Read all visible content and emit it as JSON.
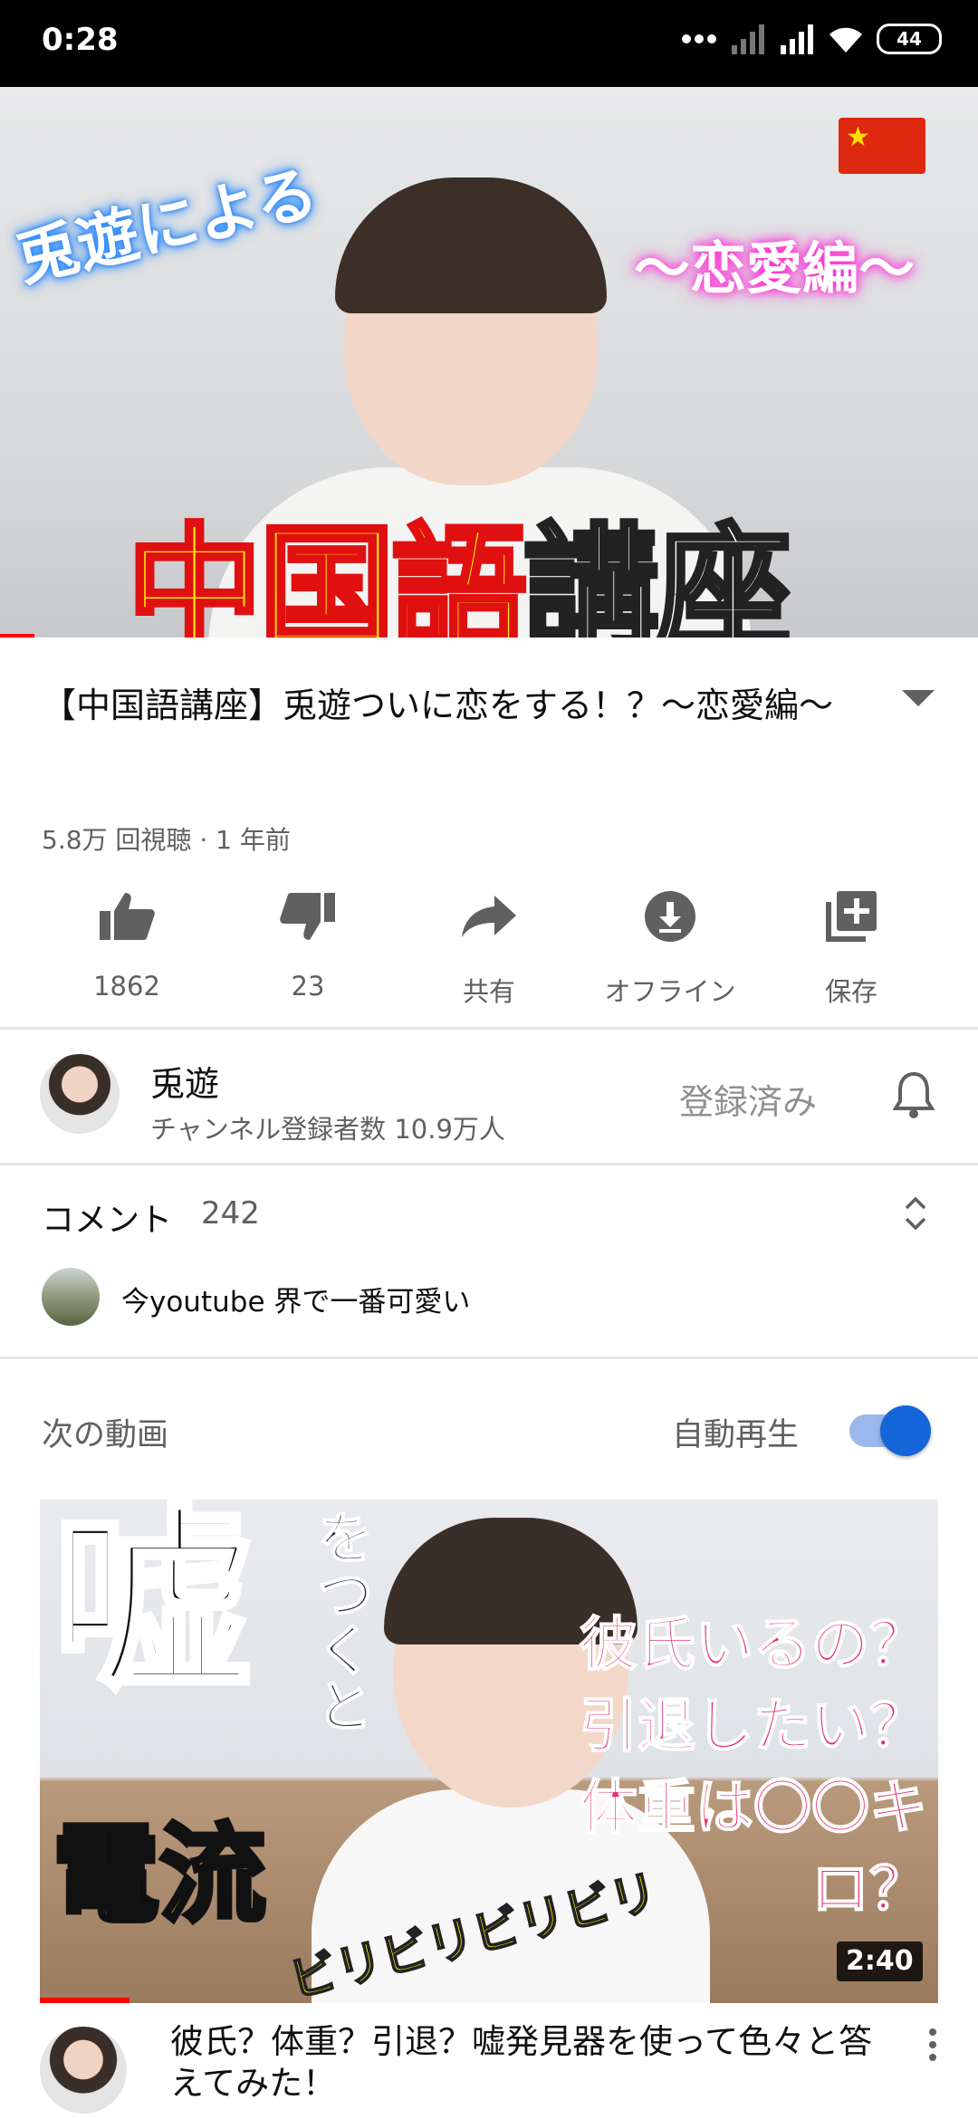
{
  "status_bar": {
    "time": "0:28",
    "battery": "44",
    "icons": [
      "dots-icon",
      "signal-off-icon",
      "signal-icon",
      "wifi-icon",
      "battery-icon"
    ]
  },
  "player": {
    "overlay_top_left": "兎遊による",
    "overlay_top_right": "～恋愛編～",
    "overlay_big_yellow": "中国語",
    "overlay_big_white": "講座",
    "flag": "china-flag",
    "progress_fraction": 0.035
  },
  "video": {
    "title": "【中国語講座】兎遊ついに恋をする！？～恋愛編～",
    "meta": "5.8万 回視聴 · 1 年前"
  },
  "actions": [
    {
      "icon": "thumbs-up-icon",
      "label": "1862"
    },
    {
      "icon": "thumbs-down-icon",
      "label": "23"
    },
    {
      "icon": "share-icon",
      "label": "共有"
    },
    {
      "icon": "download-icon",
      "label": "オフライン"
    },
    {
      "icon": "save-playlist-icon",
      "label": "保存"
    }
  ],
  "channel": {
    "name": "兎遊",
    "subscribers": "チャンネル登録者数 10.9万人",
    "subscribed_label": "登録済み"
  },
  "comments": {
    "label": "コメント",
    "count": "242",
    "top_comment": "今youtube 界で一番可愛い"
  },
  "up_next": {
    "label": "次の動画",
    "autoplay_label": "自動再生",
    "autoplay_on": true,
    "thumb_text": {
      "uso": "嘘",
      "wotsukuto": "をつくと",
      "denryu": "電流",
      "line1": "彼氏いるの？",
      "line2": "引退したい？",
      "line3": "体重は〇〇キロ？",
      "biri": "ビリビリビリビリ"
    },
    "duration": "2:40",
    "title": "彼氏？体重？引退？嘘発見器を使って色々と答えてみた！",
    "progress_fraction": 0.1
  },
  "colors": {
    "accent_red": "#ff0000",
    "toggle_blue": "#1565d8",
    "secondary_text": "#606060"
  }
}
